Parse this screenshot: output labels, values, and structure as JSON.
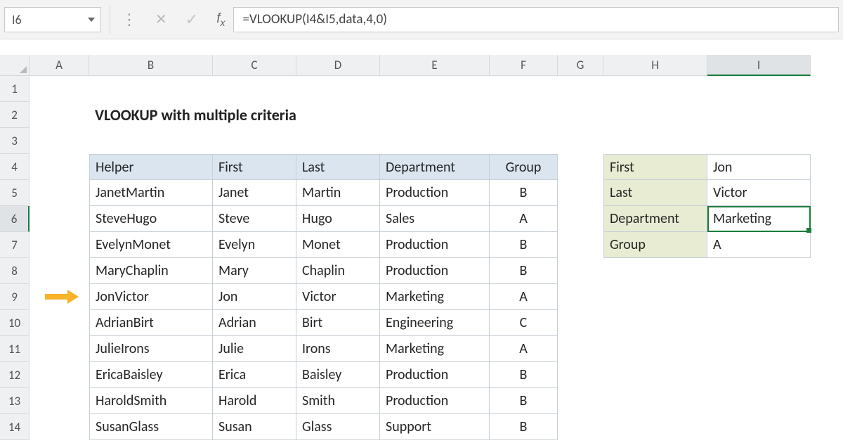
{
  "namebox": "I6",
  "formula": "=VLOOKUP(I4&I5,data,4,0)",
  "columns": [
    "A",
    "B",
    "C",
    "D",
    "E",
    "F",
    "G",
    "H",
    "I"
  ],
  "rows": [
    "1",
    "2",
    "3",
    "4",
    "5",
    "6",
    "7",
    "8",
    "9",
    "10",
    "11",
    "12",
    "13",
    "14"
  ],
  "title": "VLOOKUP with multiple criteria",
  "table": {
    "headers": [
      "Helper",
      "First",
      "Last",
      "Department",
      "Group"
    ],
    "rows": [
      [
        "JanetMartin",
        "Janet",
        "Martin",
        "Production",
        "B"
      ],
      [
        "SteveHugo",
        "Steve",
        "Hugo",
        "Sales",
        "A"
      ],
      [
        "EvelynMonet",
        "Evelyn",
        "Monet",
        "Production",
        "B"
      ],
      [
        "MaryChaplin",
        "Mary",
        "Chaplin",
        "Production",
        "B"
      ],
      [
        "JonVictor",
        "Jon",
        "Victor",
        "Marketing",
        "A"
      ],
      [
        "AdrianBirt",
        "Adrian",
        "Birt",
        "Engineering",
        "C"
      ],
      [
        "JulieIrons",
        "Julie",
        "Irons",
        "Marketing",
        "A"
      ],
      [
        "EricaBaisley",
        "Erica",
        "Baisley",
        "Production",
        "B"
      ],
      [
        "HaroldSmith",
        "Harold",
        "Smith",
        "Production",
        "B"
      ],
      [
        "SusanGlass",
        "Susan",
        "Glass",
        "Support",
        "B"
      ]
    ]
  },
  "lookup": {
    "labels": [
      "First",
      "Last",
      "Department",
      "Group"
    ],
    "values": [
      "Jon",
      "Victor",
      "Marketing",
      "A"
    ]
  },
  "active_cell": "I6",
  "arrow_row": 9
}
